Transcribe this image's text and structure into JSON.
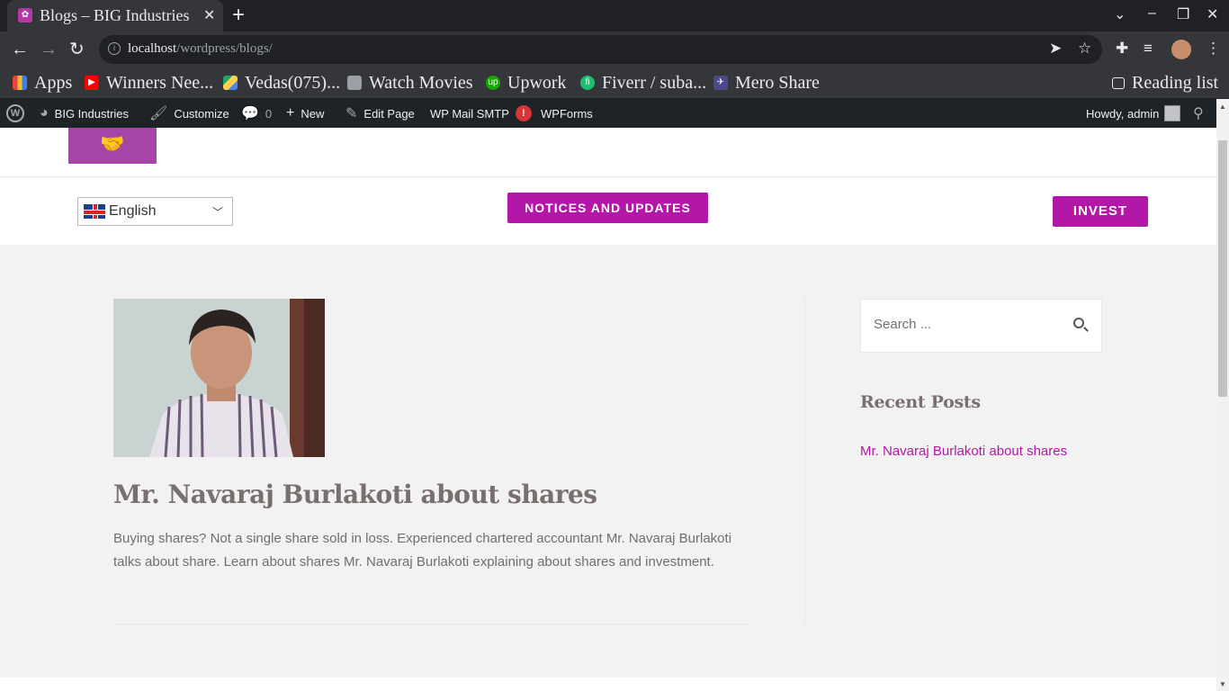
{
  "browser": {
    "tab_title": "Blogs – BIG Industries",
    "tab_close": "✕",
    "new_tab": "+",
    "url_host": "localhost",
    "url_path": "/wordpress/blogs/",
    "bookmarks": [
      {
        "label": "Apps",
        "icon": "apps-grid-icon",
        "color": "#e8453c"
      },
      {
        "label": "Winners Nee...",
        "icon": "youtube-icon",
        "color": "#ff0000"
      },
      {
        "label": "Vedas(075)...",
        "icon": "google-drive-icon",
        "color": "#1fa463"
      },
      {
        "label": "Watch Movies",
        "icon": "folder-icon",
        "color": "#e8eaed"
      },
      {
        "label": "Upwork",
        "icon": "upwork-icon",
        "color": "#14a800"
      },
      {
        "label": "Fiverr / suba...",
        "icon": "fiverr-icon",
        "color": "#1dbf73"
      },
      {
        "label": "Mero Share",
        "icon": "mero-share-icon",
        "color": "#4a4a8a"
      }
    ],
    "reading_list": "Reading list"
  },
  "adminbar": {
    "site_name": "BIG Industries",
    "customize": "Customize",
    "comments_count": "0",
    "new": "New",
    "edit_page": "Edit Page",
    "wp_mail_smtp": "WP Mail SMTP",
    "smtp_badge": "!",
    "wpforms": "WPForms",
    "howdy": "Howdy, admin"
  },
  "site": {
    "language": "English",
    "notices_button": "NOTICES AND UPDATES",
    "invest_button": "INVEST",
    "brand_color": "#b317a8"
  },
  "post": {
    "title": "Mr. Navaraj Burlakoti about shares",
    "excerpt": "Buying shares? Not a single share sold in loss. Experienced chartered accountant Mr. Navaraj Burlakoti talks about share. Learn about shares Mr. Navaraj Burlakoti explaining about shares and investment."
  },
  "sidebar": {
    "search_placeholder": "Search ...",
    "recent_posts_title": "Recent Posts",
    "recent_posts": [
      "Mr. Navaraj Burlakoti about shares"
    ]
  }
}
